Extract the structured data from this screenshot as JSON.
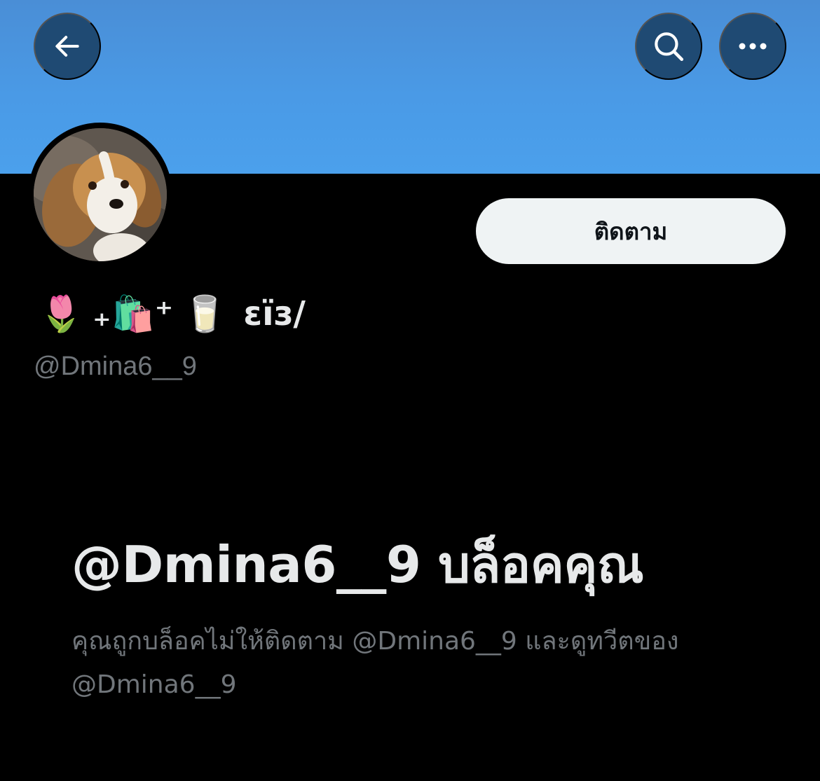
{
  "header": {
    "back_icon": "arrow-left-icon",
    "search_icon": "search-icon",
    "more_icon": "more-horizontal-icon",
    "banner_color": "#4a9ae6"
  },
  "profile": {
    "follow_label": "ติดตาม",
    "display_name_emoji": "🌷 ₊🛍️⁺ 🥛",
    "display_name_text": "εïз/",
    "handle": "@Dmina6__9"
  },
  "blocked": {
    "title": "@Dmina6__9 บล็อคคุณ",
    "description": "คุณถูกบล็อคไม่ให้ติดตาม @Dmina6__9 และดูทวีตของ @Dmina6__9"
  }
}
